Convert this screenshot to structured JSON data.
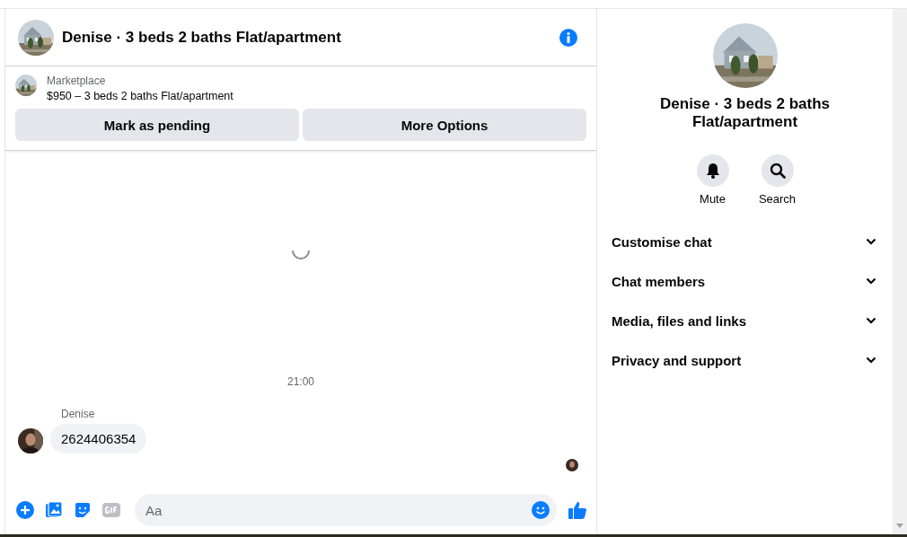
{
  "conversation": {
    "title": "Denise · 3 beds 2 baths Flat/apartment"
  },
  "listing": {
    "source": "Marketplace",
    "title": "$950 – 3 beds 2 baths Flat/apartment",
    "buttons": [
      "Mark as pending",
      "More Options"
    ]
  },
  "thread": {
    "loading": true,
    "timestamp": "21:00",
    "messages": [
      {
        "sender": "Denise",
        "text": "2624406354"
      }
    ],
    "seen": true
  },
  "composer": {
    "placeholder": "Aa"
  },
  "details": {
    "title": "Denise · 3 beds 2 baths Flat/apartment",
    "actions": [
      {
        "kind": "mute",
        "label": "Mute"
      },
      {
        "kind": "search",
        "label": "Search"
      }
    ],
    "sections": [
      {
        "label": "Customise chat",
        "expanded": false
      },
      {
        "label": "Chat members",
        "expanded": false
      },
      {
        "label": "Media, files and links",
        "expanded": false
      },
      {
        "label": "Privacy and support",
        "expanded": false
      }
    ]
  }
}
